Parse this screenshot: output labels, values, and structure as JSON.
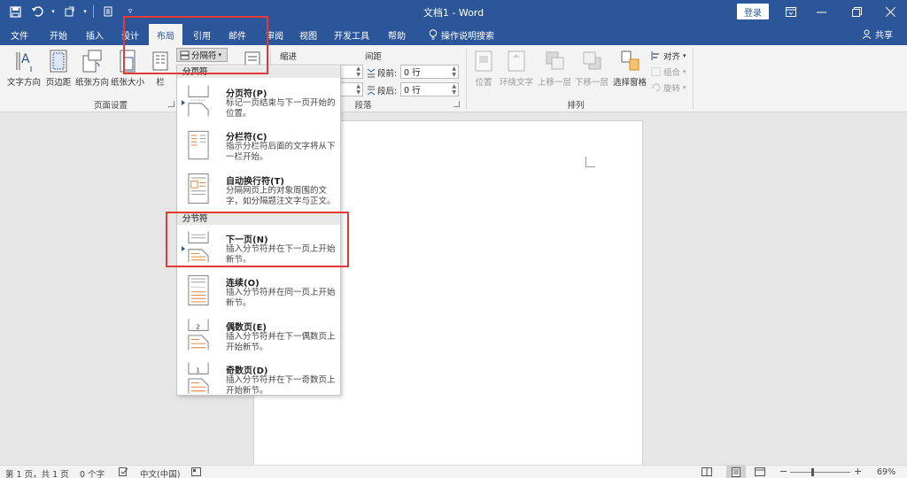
{
  "titlebar": {
    "title": "文档1 - Word",
    "login": "登录",
    "icons": [
      "save-icon",
      "undo-icon",
      "redo-icon",
      "customize-icon",
      "ribbon-display-icon",
      "minimize-icon",
      "restore-icon",
      "close-icon"
    ],
    "color": "#2b579a"
  },
  "tabs": [
    {
      "label": "文件"
    },
    {
      "label": "开始"
    },
    {
      "label": "插入"
    },
    {
      "label": "设计"
    },
    {
      "label": "布局"
    },
    {
      "label": "引用"
    },
    {
      "label": "邮件"
    },
    {
      "label": "审阅"
    },
    {
      "label": "视图"
    },
    {
      "label": "开发工具"
    },
    {
      "label": "帮助"
    },
    {
      "label": "操作说明搜索"
    }
  ],
  "share": "共享",
  "ribbon": {
    "page_setup": {
      "buttons": [
        "文字方向",
        "页边距",
        "纸张方向",
        "纸张大小",
        "栏"
      ],
      "label": "页面设置"
    },
    "breaks_label": "分隔符",
    "paragraph": {
      "indent_label": "缩进",
      "spacing_label": "间距",
      "before_label": "段前:",
      "after_label": "段后:",
      "before_value": "0 行",
      "after_value": "0 行",
      "label": "段落"
    },
    "arrange": {
      "buttons": [
        "位置",
        "环绕文字",
        "上移一层",
        "下移一层",
        "选择窗格"
      ],
      "align": "对齐",
      "group": "组合",
      "rotate": "旋转",
      "label": "排列"
    }
  },
  "menu": {
    "section1": "分页符",
    "section2": "分节符",
    "items": [
      {
        "title": "分页符(P)",
        "desc": "标记一页结束与下一页开始的位置。"
      },
      {
        "title": "分栏符(C)",
        "desc": "指示分栏符后面的文字将从下一栏开始。"
      },
      {
        "title": "自动换行符(T)",
        "desc": "分隔网页上的对象周围的文字，如分隔题注文字与正文。"
      },
      {
        "title": "下一页(N)",
        "desc": "插入分节符并在下一页上开始新节。"
      },
      {
        "title": "连续(O)",
        "desc": "插入分节符并在同一页上开始新节。"
      },
      {
        "title": "偶数页(E)",
        "desc": "插入分节符并在下一偶数页上开始新节。",
        "num": "2"
      },
      {
        "title": "奇数页(D)",
        "desc": "插入分节符并在下一奇数页上开始新节。",
        "num": "1"
      }
    ]
  },
  "status": {
    "page": "第 1 页，共 1 页",
    "words": "0 个字",
    "lang": "中文(中国)",
    "zoom": "69%"
  }
}
